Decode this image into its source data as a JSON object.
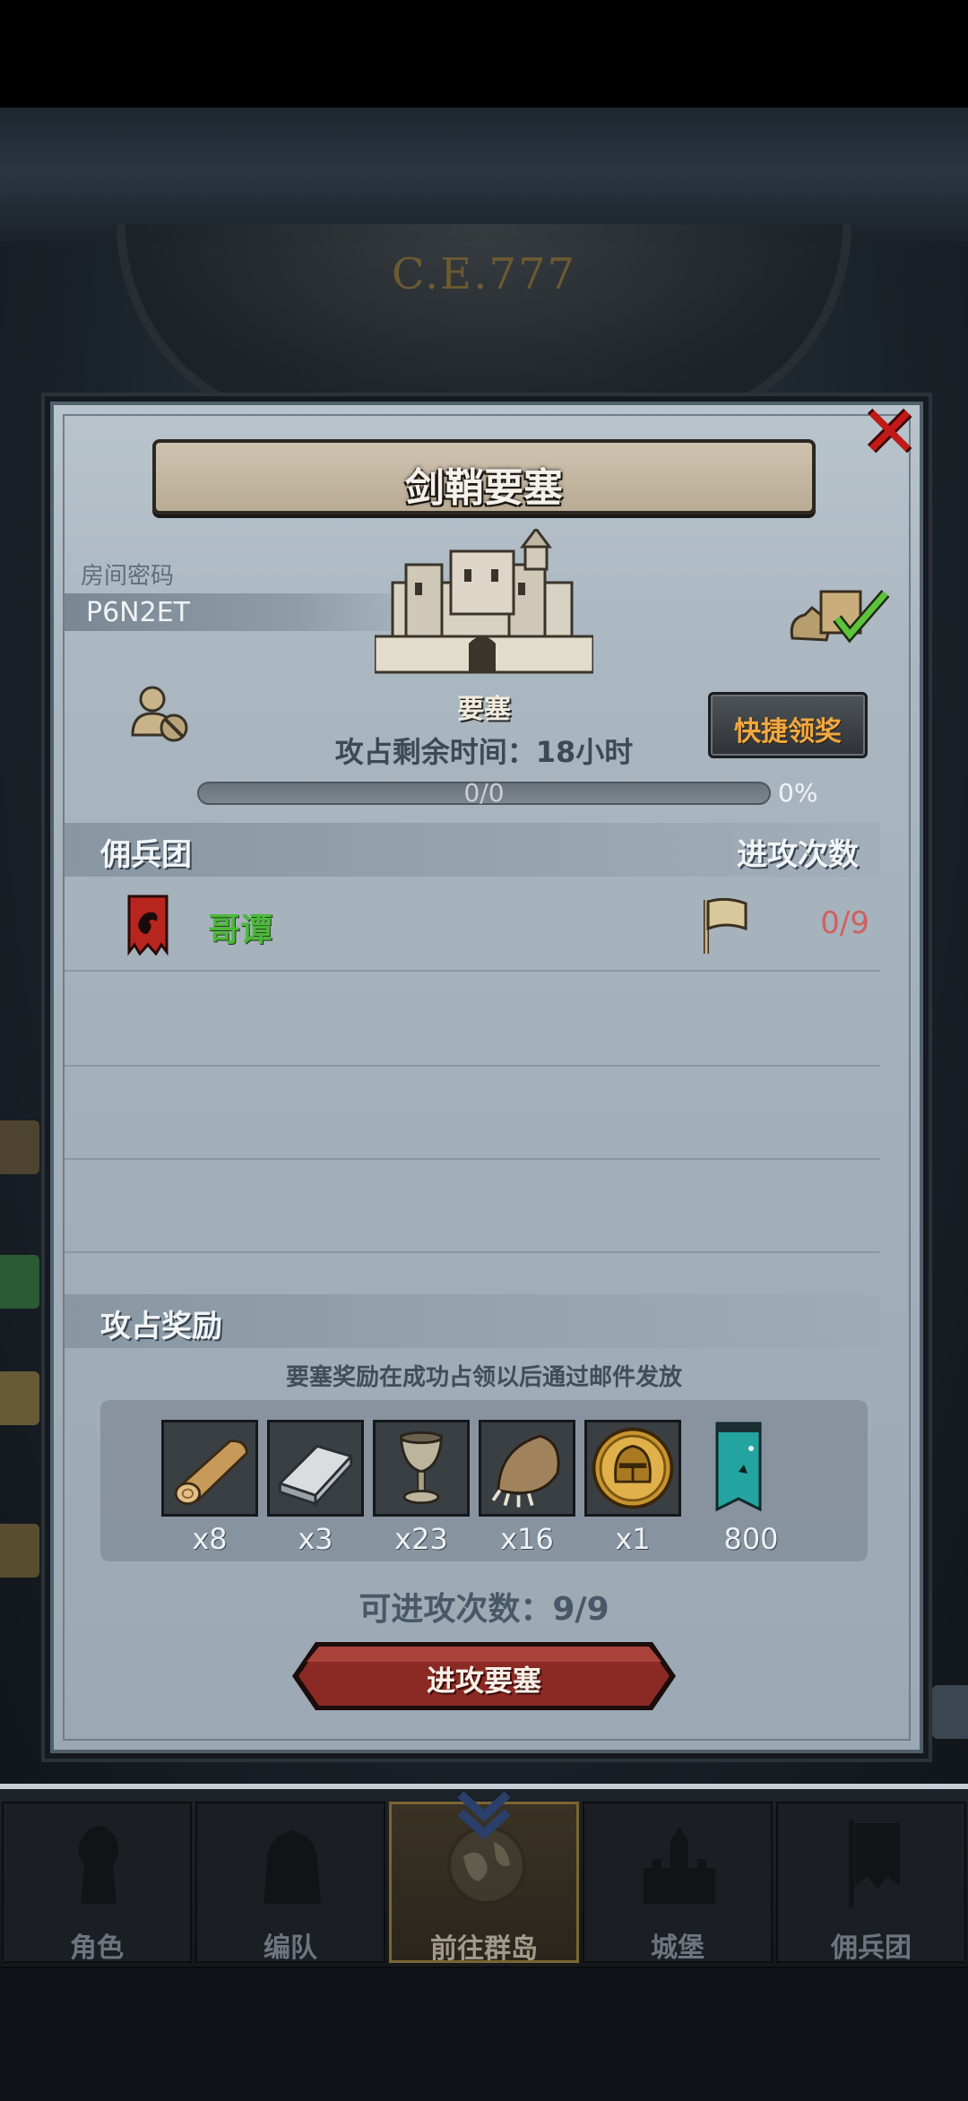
{
  "background": {
    "era_label": "C.E.777"
  },
  "dialog": {
    "title": "剑鞘要塞",
    "room_password_label": "房间密码",
    "room_password": "P6N2ET",
    "fortress_label": "要塞",
    "remaining_time": "攻占剩余时间：18小时",
    "quick_claim_label": "快捷领奖",
    "progress": {
      "text": "0/0",
      "percent_text": "0%",
      "fraction": 0
    },
    "mercenary_header": "佣兵团",
    "attack_count_header": "进攻次数",
    "mercenaries": [
      {
        "name": "哥谭",
        "attack_count": "0/9"
      }
    ],
    "reward_header": "攻占奖励",
    "reward_note": "要塞奖励在成功占领以后通过邮件发放",
    "rewards": [
      {
        "icon": "wood-log-icon",
        "qty": "x8"
      },
      {
        "icon": "iron-ingot-icon",
        "qty": "x3"
      },
      {
        "icon": "goblet-icon",
        "qty": "x23"
      },
      {
        "icon": "fur-pelt-icon",
        "qty": "x16"
      },
      {
        "icon": "knight-helmet-coin-icon",
        "qty": "x1"
      },
      {
        "icon": "moon-banner-icon",
        "qty": "800"
      }
    ],
    "attempts": "可进攻次数：9/9",
    "attack_button": "进攻要塞"
  },
  "bottom_nav": [
    {
      "label": "角色",
      "icon": "knight-icon",
      "active": false
    },
    {
      "label": "编队",
      "icon": "armor-icon",
      "active": false
    },
    {
      "label": "前往群岛",
      "icon": "globe-icon",
      "active": true
    },
    {
      "label": "城堡",
      "icon": "castle-icon",
      "active": false
    },
    {
      "label": "佣兵团",
      "icon": "banner-icon",
      "active": false
    }
  ],
  "colors": {
    "title_text": "#f4f0ea",
    "close": "#c21a18",
    "merc_name": "#4cb83a",
    "attack_count": "#d06060",
    "quick_claim": "#f0a842",
    "attack_button": "#8b2a24"
  }
}
